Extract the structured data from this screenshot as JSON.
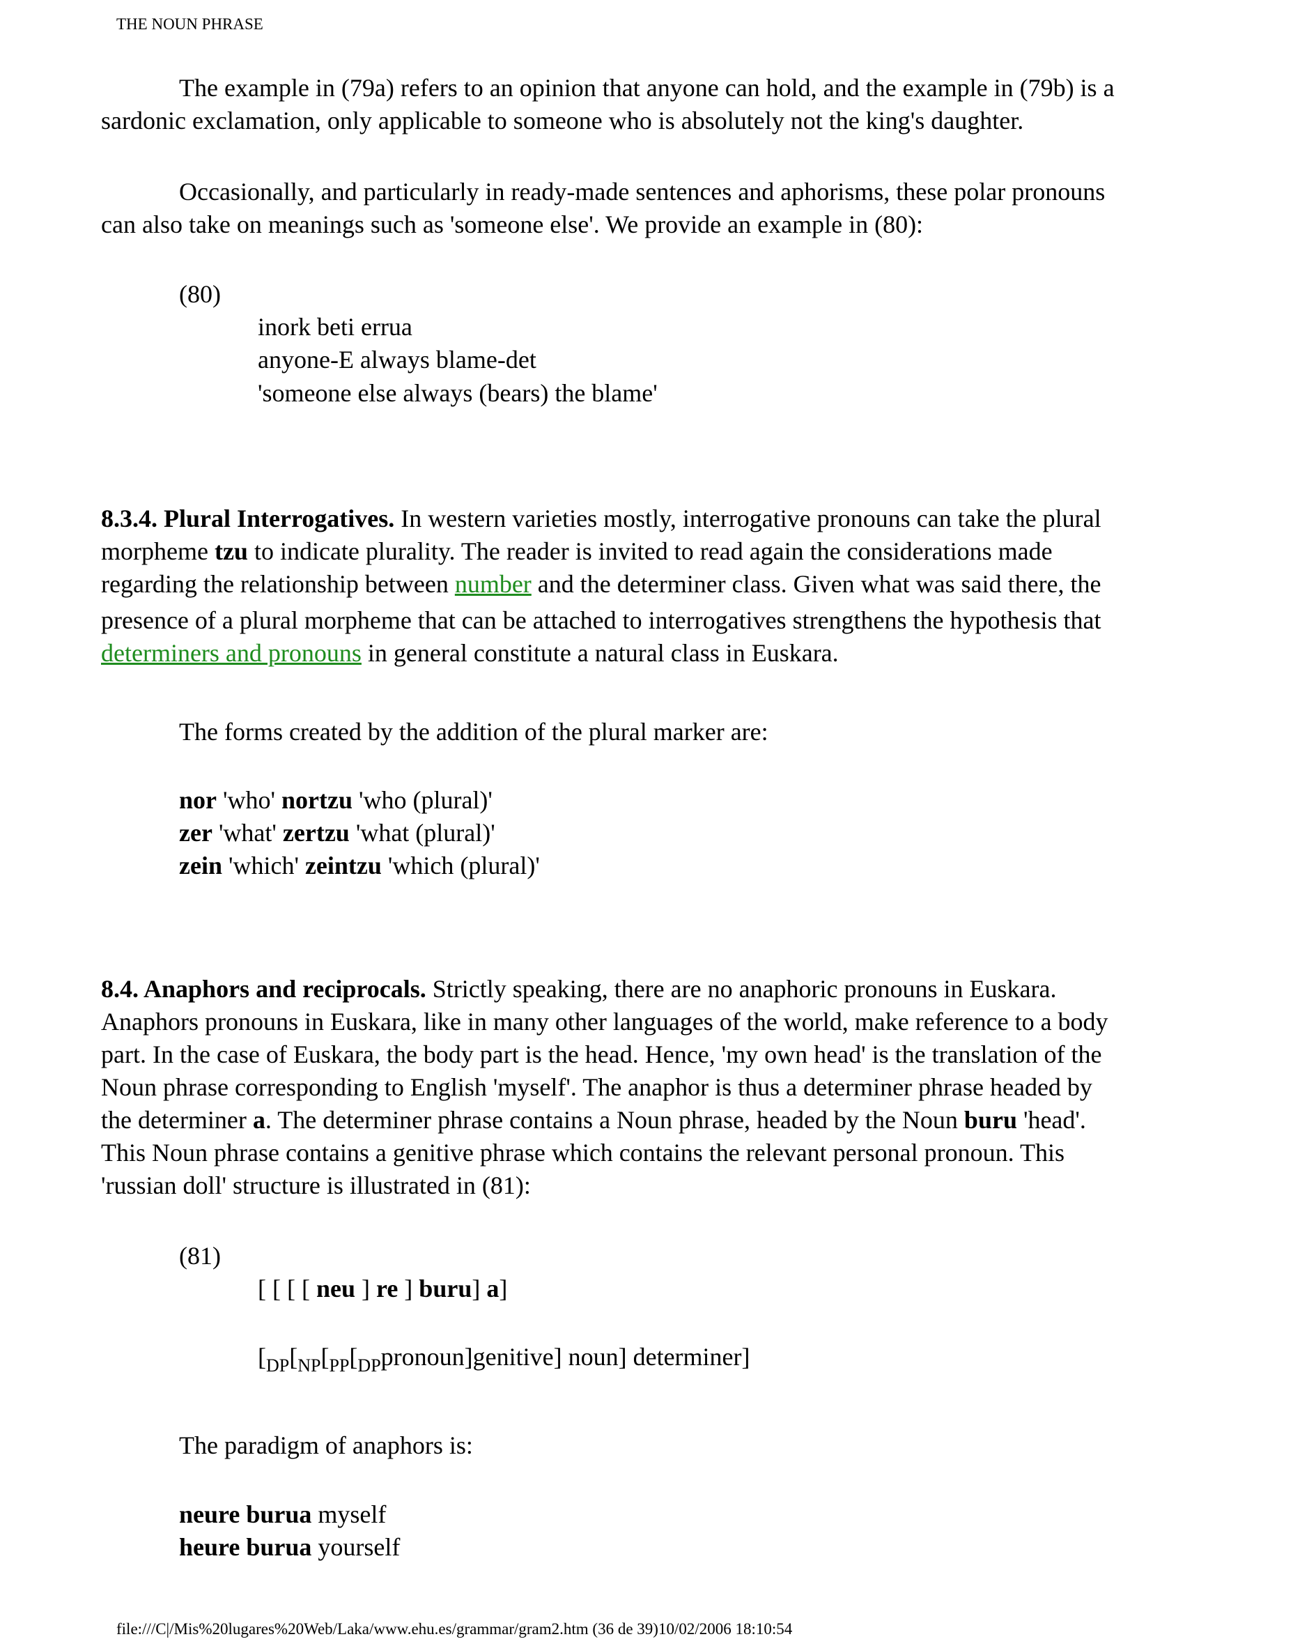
{
  "header": {
    "running_title": "THE NOUN PHRASE"
  },
  "para1": {
    "line1": "The example in (79a) refers to an opinion that anyone can hold, and the example in (79b) is a",
    "line2": "sardonic exclamation, only applicable to someone who is absolutely not the king's daughter."
  },
  "para2": {
    "line1": "Occasionally, and particularly in ready-made sentences and aphorisms, these polar pronouns",
    "line2": "can also take on meanings such as 'someone else'. We provide an example in (80):"
  },
  "example80": {
    "number": "(80)",
    "basque": "inork beti errua",
    "gloss": "anyone-E always blame-det",
    "translation": "'someone else always (bears) the blame'"
  },
  "section834": {
    "heading": "8.3.4. Plural Interrogatives.",
    "l1_rest": " In western varieties mostly, interrogative pronouns can take the plural",
    "l2_a": "morpheme ",
    "l2_bold": "tzu",
    "l2_b": " to indicate plurality. The reader is invited to read again the considerations made",
    "l3_a": "regarding the relationship between ",
    "l3_link": "number",
    "l3_b": " and the determiner class. Given what was said there, the",
    "l4": "presence of a plural morpheme that can be attached to interrogatives strengthens the hypothesis that",
    "l5_link": "determiners and pronouns",
    "l5_rest": " in general constitute a natural class in Euskara.",
    "forms_intro": "The forms created by the addition of the plural marker are:",
    "forms": [
      {
        "word": "nor",
        "gloss": " 'who' ",
        "plural": "nortzu",
        "plural_gloss": " 'who (plural)'"
      },
      {
        "word": "zer",
        "gloss": " 'what' ",
        "plural": "zertzu",
        "plural_gloss": " 'what (plural)'"
      },
      {
        "word": "zein",
        "gloss": " 'which' ",
        "plural": "zeintzu",
        "plural_gloss": " 'which (plural)'"
      }
    ]
  },
  "section84": {
    "heading": "8.4. Anaphors and reciprocals.",
    "l1_rest": " Strictly speaking, there are no anaphoric pronouns in Euskara.",
    "l2": "Anaphors pronouns in Euskara, like in many other languages of the world, make reference to a body",
    "l3": "part. In the case of Euskara, the body part is the head. Hence, 'my own head' is the translation of the",
    "l4": "Noun phrase corresponding to English 'myself'. The anaphor is thus a determiner phrase headed by",
    "l5_a": "the determiner ",
    "l5_bold": "a",
    "l5_b": ". The determiner phrase contains a Noun phrase, headed by the Noun ",
    "l5_bold2": "buru",
    "l5_c": " 'head'.",
    "l6": "This Noun phrase contains a genitive phrase which contains the relevant personal pronoun. This",
    "l7": "'russian doll' structure is illustrated in (81):"
  },
  "example81": {
    "number": "(81)",
    "br1": "[ [ [ [ ",
    "neu": "neu",
    "br2": " ] ",
    "re": "re",
    "br3": " ] ",
    "buru": "buru",
    "br4": "] ",
    "a": "a",
    "br5": "]",
    "open1": "[",
    "sub_dp1": "DP",
    "open2": "[",
    "sub_np": "NP",
    "open3": "[",
    "sub_pp": "PP",
    "open4": "[",
    "sub_dp2": "DP",
    "tree_rest": "pronoun]genitive] noun] determiner]"
  },
  "paradigm": {
    "intro": "The paradigm of anaphors is:",
    "items": [
      {
        "form": "neure burua",
        "meaning": " myself"
      },
      {
        "form": "heure burua",
        "meaning": " yourself"
      }
    ]
  },
  "footer": {
    "path": "file:///C|/Mis%20lugares%20Web/Laka/www.ehu.es/grammar/gram2.htm (36 de 39)10/02/2006 18:10:54"
  }
}
